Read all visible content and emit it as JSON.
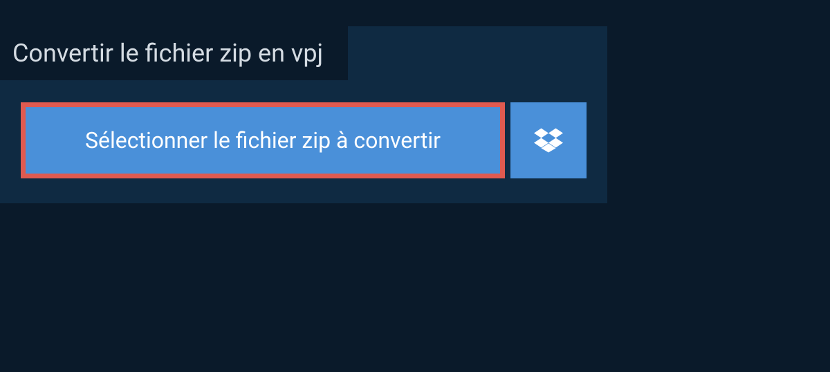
{
  "header": {
    "title": "Convertir le fichier zip en vpj"
  },
  "actions": {
    "select_file_label": "Sélectionner le fichier zip à convertir"
  }
}
